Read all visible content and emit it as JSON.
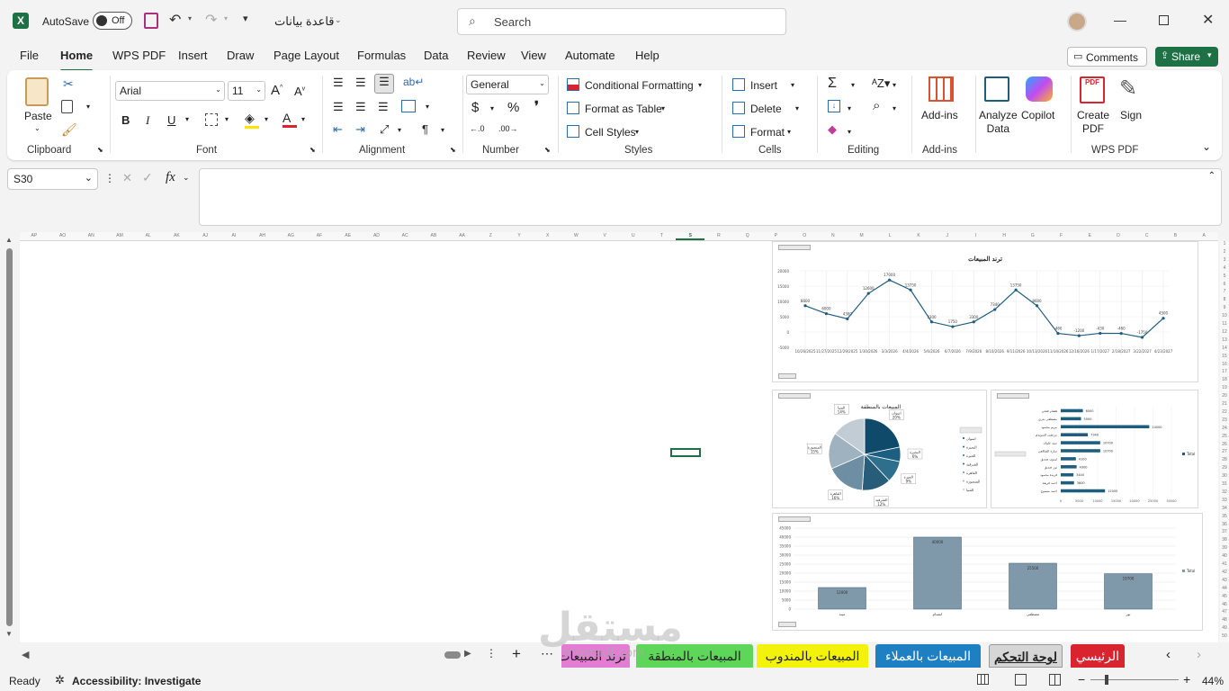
{
  "titlebar": {
    "autosave_label": "AutoSave",
    "autosave_state": "Off",
    "file_name": "قاعدة بيانات",
    "search_placeholder": "Search",
    "accent": "#1e7145"
  },
  "menu": [
    "File",
    "Home",
    "WPS PDF",
    "Insert",
    "Draw",
    "Page Layout",
    "Formulas",
    "Data",
    "Review",
    "View",
    "Automate",
    "Help"
  ],
  "menu_active": "Home",
  "comments_label": "Comments",
  "share_label": "Share",
  "ribbon": {
    "clipboard": {
      "paste": "Paste",
      "group": "Clipboard"
    },
    "font": {
      "name": "Arial",
      "size": "11",
      "group": "Font",
      "bold": "B",
      "italic": "I",
      "underline": "U"
    },
    "alignment": {
      "group": "Alignment"
    },
    "number": {
      "format": "General",
      "group": "Number"
    },
    "styles": {
      "conditional": "Conditional Formatting",
      "table": "Format as Table",
      "cell": "Cell Styles",
      "group": "Styles"
    },
    "cells": {
      "insert": "Insert",
      "delete": "Delete",
      "format": "Format",
      "group": "Cells"
    },
    "editing": {
      "group": "Editing"
    },
    "addins": {
      "label": "Add-ins",
      "group": "Add-ins"
    },
    "analyze": {
      "line1": "Analyze",
      "line2": "Data"
    },
    "copilot": "Copilot",
    "wps": {
      "create1": "Create",
      "create2": "PDF",
      "sign": "Sign",
      "group": "WPS PDF"
    }
  },
  "namebox": "S30",
  "fx_symbol": "fx",
  "column_headers": [
    "AP",
    "AO",
    "AN",
    "AM",
    "AL",
    "AK",
    "AJ",
    "AI",
    "AH",
    "AG",
    "AF",
    "AE",
    "AD",
    "AC",
    "AB",
    "AA",
    "Z",
    "Y",
    "X",
    "W",
    "V",
    "U",
    "T",
    "S",
    "R",
    "Q",
    "P",
    "O",
    "N",
    "M",
    "L",
    "K",
    "J",
    "I",
    "H",
    "G",
    "F",
    "E",
    "D",
    "C",
    "B",
    "A"
  ],
  "sheet_tabs": [
    {
      "label": "ترند المبيعات",
      "color": "#e37dd3"
    },
    {
      "label": "المبيعات بالمنطقة",
      "color": "#5dd65a"
    },
    {
      "label": "المبيعات بالمندوب",
      "color": "#f2f20a"
    },
    {
      "label": "المبيعات بالعملاء",
      "color": "#1f7fc3"
    },
    {
      "label": "لوحة التحكم",
      "color": "#cfcfcf"
    },
    {
      "label": "الرئيسي",
      "color": "#d9232e"
    }
  ],
  "status": {
    "ready": "Ready",
    "accessibility": "Accessibility: Investigate",
    "zoom": "44%"
  },
  "watermark": {
    "main": "مستقل",
    "sub": "mostaql.com"
  },
  "chart_data": [
    {
      "type": "line",
      "title": "ترند المبيعات",
      "x": [
        "10/26/2025",
        "11/27/2025",
        "12/29/2025",
        "1/30/2026",
        "3/3/2026",
        "4/4/2026",
        "5/6/2026",
        "6/7/2026",
        "7/9/2026",
        "8/10/2026",
        "9/11/2026",
        "10/13/2026",
        "11/14/2026",
        "12/16/2026",
        "1/17/2027",
        "2/18/2027",
        "3/22/2027",
        "4/23/2027"
      ],
      "series": [
        {
          "values": [
            8600,
            6000,
            4300,
            12600,
            17000,
            13750,
            3300,
            1750,
            3300,
            7340,
            13750,
            8600,
            -460,
            -1200,
            -430,
            -460,
            -1750,
            4500
          ]
        }
      ],
      "ylim": [
        -5000,
        20000
      ],
      "yticks": [
        "20000",
        "15000",
        "10000",
        "5000",
        "0",
        "-5000"
      ],
      "color": "#1f5d7e"
    },
    {
      "type": "pie",
      "title": "المبيعات بالمنطقة",
      "labels": [
        "اسوان",
        "البحيرة",
        "الجيزة",
        "الشرقية",
        "القاهرة",
        "المنصورة",
        "المنيا"
      ],
      "values": [
        20,
        6,
        9,
        12,
        16,
        15,
        14
      ],
      "data_labels": [
        "اسوان 20%",
        "البحيرة 6%",
        "الجيزة 9%",
        "الشرقية 12%",
        "القاهرة 16%",
        "المنصورة 15%",
        "المنيا 14%"
      ],
      "legend": "right"
    },
    {
      "type": "bar",
      "orientation": "horizontal",
      "categories": [
        "هشام فتحي",
        "مصطفى بدري",
        "مريم محمود",
        "مرتضى السويدي",
        "سيد علوان",
        "سارة الشافعي",
        "ليمون صديق",
        "نور صديق",
        "فريدة محمود",
        "احمد فريفة",
        "احمد منسوح"
      ],
      "values": [
        6000,
        5500,
        24000,
        7340,
        10700,
        10700,
        4100,
        4300,
        3440,
        3600,
        12000
      ],
      "xlim": [
        0,
        30000
      ],
      "legend": "right",
      "series_name": "Total",
      "color": "#1f5d7e"
    },
    {
      "type": "bar",
      "categories": [
        "ميند",
        "ابتسام",
        "مصطفى",
        "نور"
      ],
      "values": [
        12000,
        40000,
        25500,
        19700
      ],
      "ylim": [
        0,
        45000
      ],
      "yticks": [
        "45000",
        "40000",
        "35000",
        "30000",
        "25000",
        "20000",
        "15000",
        "10000",
        "5000",
        "0"
      ],
      "legend": "right",
      "series_name": "Total",
      "color": "#7f98aa"
    }
  ]
}
